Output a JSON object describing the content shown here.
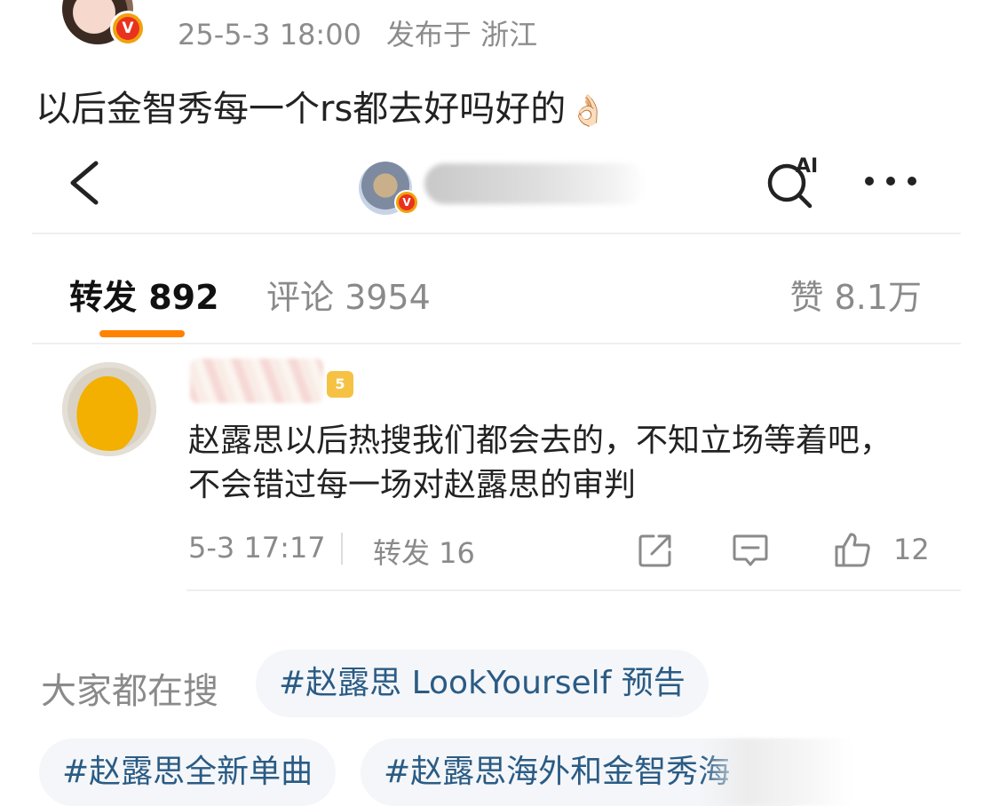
{
  "post": {
    "timestamp": "25-5-3 18:00",
    "location": "发布于 浙江",
    "text": "以后金智秀每一个rs都去好吗好的",
    "emoji": "👌🏻"
  },
  "verified_badge": "V",
  "nav": {
    "back_icon": "chevron-left-icon",
    "ai_label": "AI",
    "more_icon": "more-dots-icon"
  },
  "tabs": [
    {
      "label": "转发 892"
    },
    {
      "label": "评论 3954"
    },
    {
      "label": "赞 8.1万"
    }
  ],
  "accent_color": "#ff8200",
  "repost": {
    "level_badge": "5",
    "text": "赵露思以后热搜我们都会去的，不知立场等着吧，不会错过每一场对赵露思的审判",
    "time": "5-3 17:17",
    "repost_label": "转发 16",
    "like_count": "12"
  },
  "trending": {
    "label": "大家都在搜",
    "chips": [
      "#赵露思 LookYourself 预告",
      "#赵露思全新单曲",
      "#赵露思海外和金智秀海"
    ]
  }
}
